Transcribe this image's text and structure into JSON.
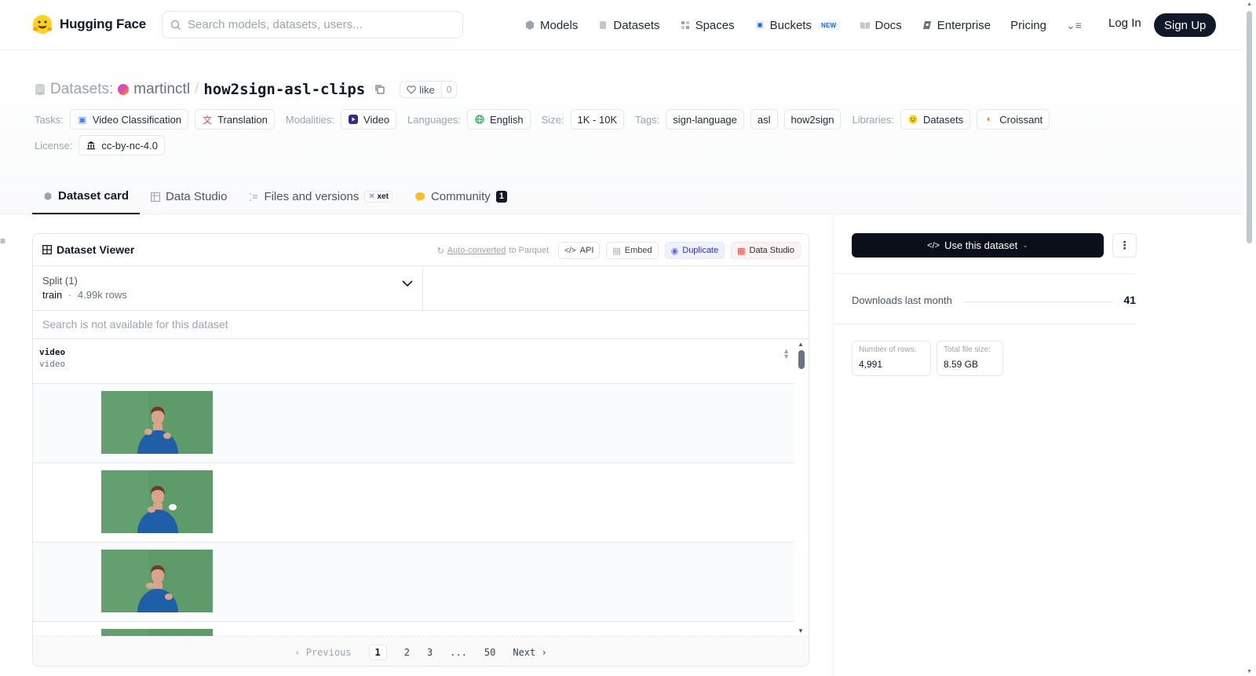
{
  "brand": {
    "name": "Hugging Face"
  },
  "search": {
    "placeholder": "Search models, datasets, users..."
  },
  "nav": {
    "models": "Models",
    "datasets": "Datasets",
    "spaces": "Spaces",
    "buckets": "Buckets",
    "buckets_badge": "NEW",
    "docs": "Docs",
    "enterprise": "Enterprise",
    "pricing": "Pricing",
    "login": "Log In",
    "signup": "Sign Up"
  },
  "repo": {
    "prefix": "Datasets:",
    "owner": "martinctl",
    "separator": "/",
    "name": "how2sign-asl-clips",
    "like_label": "like",
    "like_count": "0"
  },
  "tags": {
    "tasks_label": "Tasks:",
    "tasks": [
      "Video Classification",
      "Translation"
    ],
    "modalities_label": "Modalities:",
    "modalities": [
      "Video"
    ],
    "languages_label": "Languages:",
    "languages": [
      "English"
    ],
    "size_label": "Size:",
    "size": "1K - 10K",
    "tags_label": "Tags:",
    "tags": [
      "sign-language",
      "asl",
      "how2sign"
    ],
    "libraries_label": "Libraries:",
    "libraries": [
      "Datasets",
      "Croissant"
    ],
    "license_label": "License:",
    "license": "cc-by-nc-4.0"
  },
  "tabs": {
    "card": "Dataset card",
    "studio": "Data Studio",
    "files": "Files and versions",
    "files_badge": "xet",
    "community": "Community",
    "community_count": "1"
  },
  "viewer": {
    "title": "Dataset Viewer",
    "auto_converted": "Auto-converted",
    "auto_suffix": "to Parquet",
    "api": "API",
    "embed": "Embed",
    "duplicate": "Duplicate",
    "data_studio": "Data Studio",
    "split_label": "Split (1)",
    "split_name": "train",
    "split_dot": "·",
    "split_rows": "4.99k rows",
    "search_disabled": "Search is not available for this dataset",
    "column_name": "video",
    "column_type": "video"
  },
  "pager": {
    "previous": "Previous",
    "pages": [
      "1",
      "2",
      "3",
      "...",
      "50"
    ],
    "next": "Next"
  },
  "sidebar": {
    "use_button": "Use this dataset",
    "downloads_label": "Downloads last month",
    "downloads_value": "41",
    "rows_label": "Number of rows:",
    "rows_value": "4,991",
    "size_label": "Total file size:",
    "size_value": "8.59 GB"
  },
  "colors": {
    "accent_dark": "#111827",
    "thumb_green": "#5e9a6a",
    "shirt_blue": "#1f5fa8"
  }
}
